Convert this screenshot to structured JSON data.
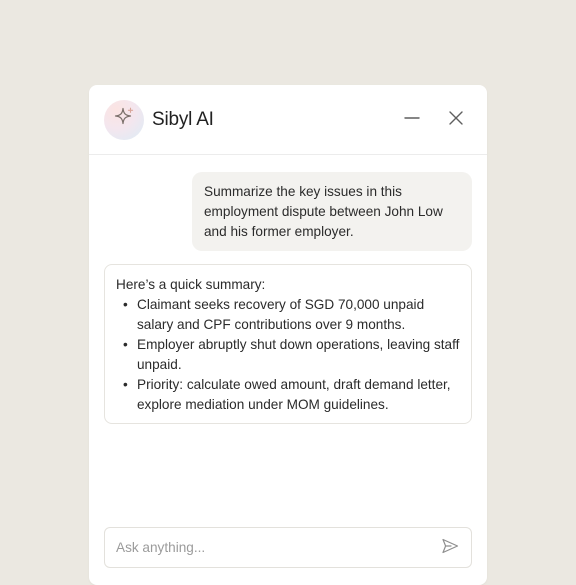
{
  "header": {
    "title": "Sibyl AI",
    "avatar_icon": "sparkle-icon",
    "minimize_icon": "minus-icon",
    "close_icon": "close-icon"
  },
  "conversation": {
    "user_message": "Summarize the key issues in this employment dispute between John Low and his former employer.",
    "ai_reply": {
      "intro": "Here’s a quick summary:",
      "bullets": [
        "Claimant seeks recovery of SGD 70,000 unpaid salary and CPF contributions over 9 months.",
        "Employer abruptly shut down operations, leaving staff unpaid.",
        "Priority: calculate owed amount, draft demand letter, explore mediation under MOM guidelines."
      ]
    }
  },
  "composer": {
    "placeholder": "Ask anything...",
    "value": "",
    "send_icon": "send-icon"
  },
  "colors": {
    "background": "#ebe8e1",
    "panel": "#ffffff",
    "user_bubble": "#f3f2ef",
    "text": "#2b2b2b",
    "placeholder": "#9b9b9b"
  }
}
